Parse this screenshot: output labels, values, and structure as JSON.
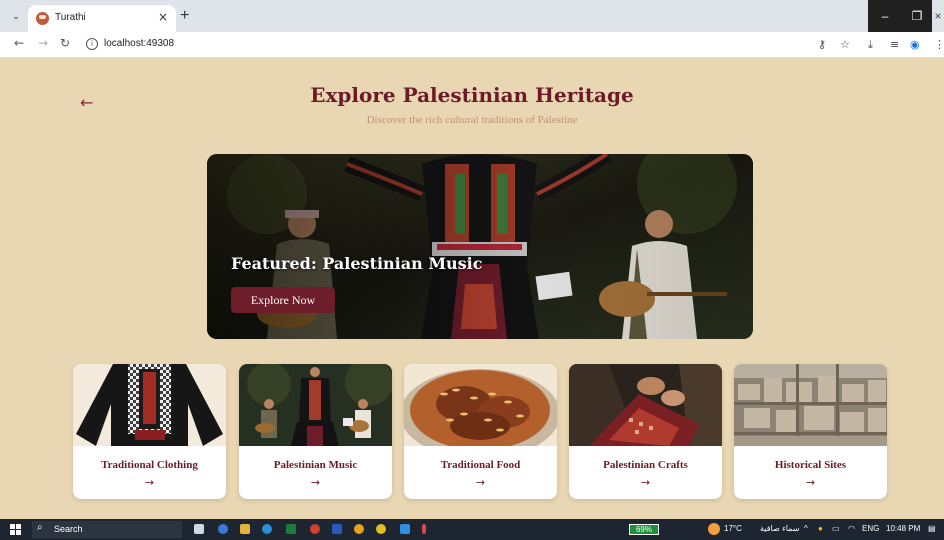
{
  "browser": {
    "tab_title": "Turathi",
    "tab_close": "×",
    "new_tab": "+",
    "url": "localhost:49308",
    "window_controls": {
      "minimize": "–",
      "maximize": "❐",
      "close": "×"
    },
    "icons": [
      "tab-menu-icon",
      "back-icon",
      "forward-icon",
      "reload-icon",
      "info-icon",
      "password-key-icon",
      "star-icon",
      "download-icon",
      "media-icon",
      "profile-icon",
      "more-icon"
    ]
  },
  "page": {
    "back_arrow": "←",
    "title": "Explore Palestinian Heritage",
    "subtitle": "Discover the rich cultural traditions of Palestine"
  },
  "hero": {
    "title": "Featured: Palestinian Music",
    "button": "Explore Now"
  },
  "categories": [
    {
      "label": "Traditional Clothing",
      "arrow": "→"
    },
    {
      "label": "Palestinian Music",
      "arrow": "→"
    },
    {
      "label": "Traditional Food",
      "arrow": "→"
    },
    {
      "label": "Palestinian Crafts",
      "arrow": "→"
    },
    {
      "label": "Historical Sites",
      "arrow": "→"
    }
  ],
  "taskbar": {
    "search_placeholder": "Search",
    "battery": "69%",
    "temperature": "17°C",
    "weather": "سماء صافية",
    "language": "ENG",
    "time": "10:48 PM"
  },
  "colors": {
    "page_background": "#e9d6b2",
    "accent": "#6e1d2b",
    "title_text": "#6b1b28",
    "subtitle_text": "#b7977a"
  }
}
